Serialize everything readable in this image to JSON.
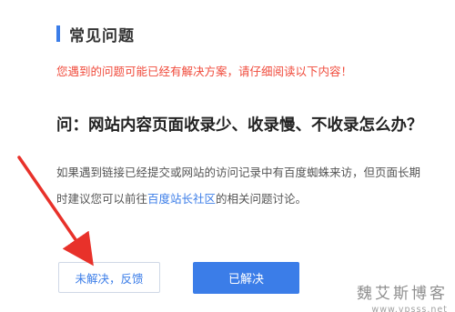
{
  "section": {
    "title": "常见问题",
    "accent_color": "#3b7de8"
  },
  "notice": "您遇到的问题可能已经有解决方案，请仔细阅读以下内容！",
  "question": "问：网站内容页面收录少、收录慢、不收录怎么办？",
  "answer": {
    "line1": "如果遇到链接已经提交或网站的访问记录中有百度蜘蛛来访，但页面长期",
    "line2_before": "时建议您可以前往",
    "line2_link": "百度站长社区",
    "line2_after": "的相关问题讨论。"
  },
  "buttons": {
    "unsolved_label": "未解决，反馈",
    "solved_label": "已解决"
  },
  "annotation": {
    "arrow_color": "#e8312a"
  },
  "watermark": {
    "name": "魏艾斯博客",
    "url": "www.vpsss.net"
  }
}
